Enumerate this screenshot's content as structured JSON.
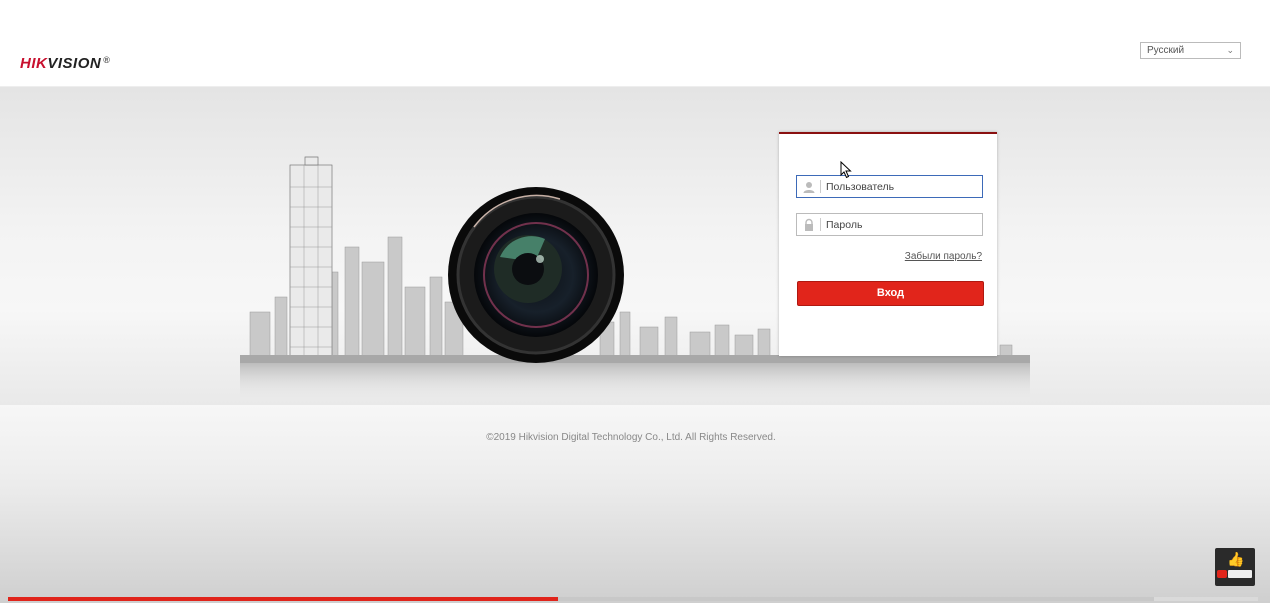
{
  "header": {
    "logo_hik": "HIK",
    "logo_vision": "VISION",
    "logo_reg": "®",
    "language": {
      "selected": "Русский"
    }
  },
  "login": {
    "username_placeholder": "Пользователь",
    "password_placeholder": "Пароль",
    "forgot_label": "Забыли пароль?",
    "submit_label": "Вход"
  },
  "footer": {
    "copyright": "©2019 Hikvision Digital Technology Co., Ltd. All Rights Reserved."
  },
  "video": {
    "progress_fraction": 0.48
  },
  "colors": {
    "brand_red": "#c8102e",
    "button_red": "#e1251b",
    "panel_top": "#8a1010"
  },
  "icons": [
    "user-icon",
    "lock-icon",
    "chevron-down-icon",
    "camera-lens-icon",
    "mouse-cursor-icon"
  ]
}
